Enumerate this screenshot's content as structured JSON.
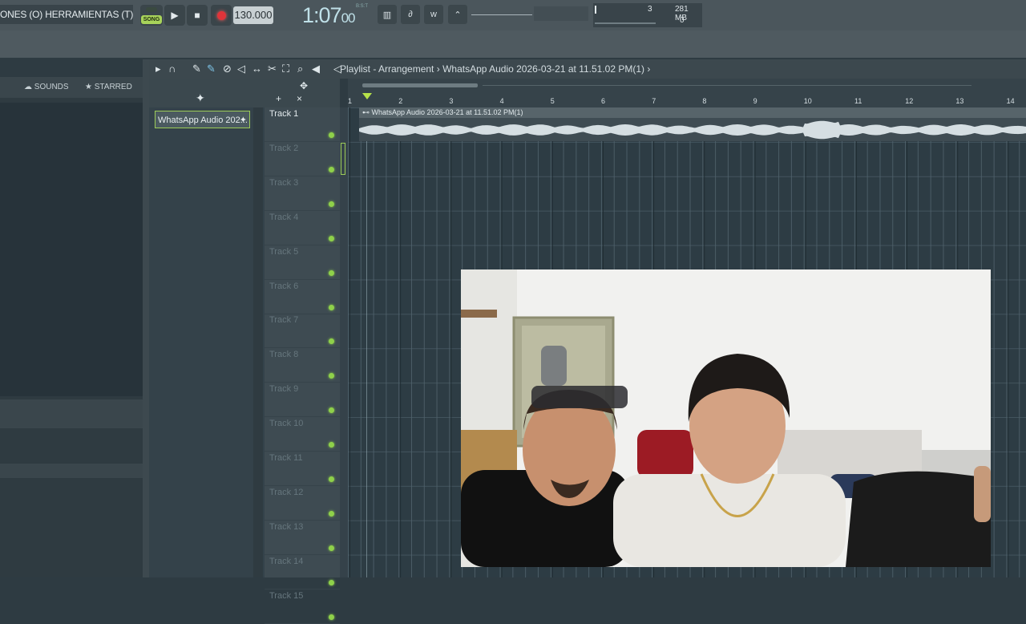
{
  "app": {
    "menu_text": "ONES (O) HERRAMIENTAS (T) AYUDA",
    "song_mode_label": "SONG",
    "tempo": "130.000",
    "time": {
      "main": "1:07",
      "sub": "00",
      "unit": "B:S:T"
    },
    "cpu": {
      "value1": "3",
      "memory": "281 MB",
      "value2": "0"
    }
  },
  "browser": {
    "tabs": [
      {
        "label": "SOUNDS",
        "icon": "cloud-icon"
      },
      {
        "label": "STARRED",
        "icon": "star-icon"
      }
    ]
  },
  "playlist": {
    "title": "Playlist - Arrangement",
    "separator": "›",
    "pattern_name": "WhatsApp Audio 2026-03-21 at 11.51.02 PM(1)",
    "picker_clip": "WhatsApp Audio 202...",
    "clip_name": "WhatsApp Audio 2026-03-21 at 11.51.02 PM(1)",
    "bars": [
      "1",
      "2",
      "3",
      "4",
      "5",
      "6",
      "7",
      "8",
      "9",
      "10",
      "11",
      "12",
      "13",
      "14"
    ],
    "tracks": [
      "Track 1",
      "Track 2",
      "Track 3",
      "Track 4",
      "Track 5",
      "Track 6",
      "Track 7",
      "Track 8",
      "Track 9",
      "Track 10",
      "Track 11",
      "Track 12",
      "Track 13",
      "Track 14",
      "Track 15"
    ]
  },
  "colors": {
    "accent_green": "#8fd14a",
    "record_red": "#e0343a",
    "grid_bg": "#2d3c44"
  }
}
